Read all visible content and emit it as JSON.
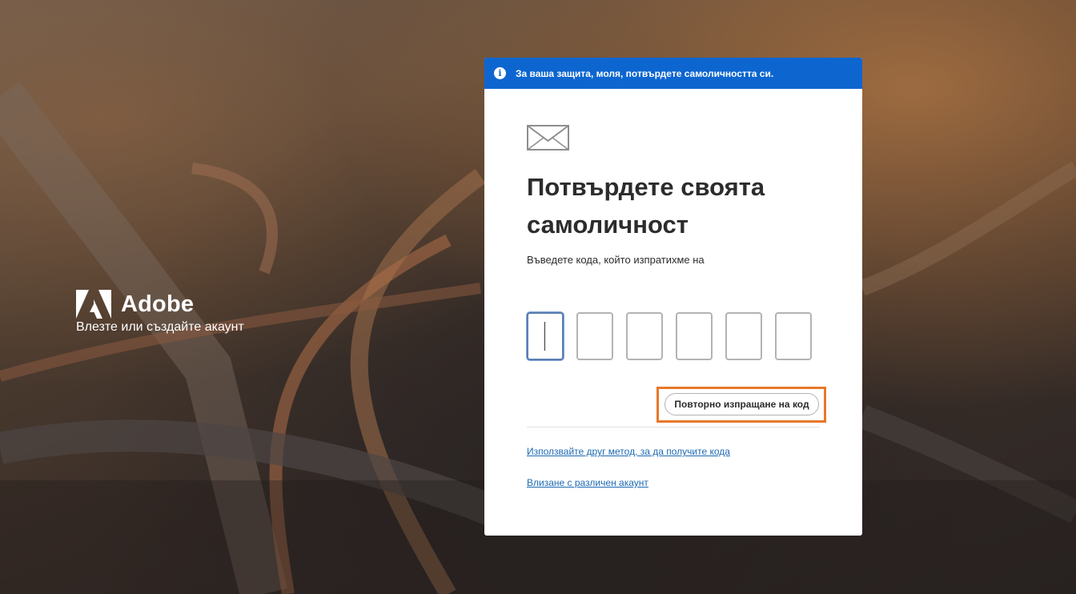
{
  "brand": {
    "name": "Adobe",
    "subtitle": "Влезте или създайте акаунт"
  },
  "banner": {
    "icon": "info-icon",
    "text": "За ваша защита, моля, потвърдете самоличността си."
  },
  "card": {
    "envelope_icon": "envelope-icon",
    "title": "Потвърдете своята самоличност",
    "subtitle": "Въведете кода, който изпратихме на",
    "code_digits": [
      "",
      "",
      "",
      "",
      "",
      ""
    ],
    "resend_label": "Повторно изпращане на код",
    "alt_method_link": "Използвайте друг метод, за да получите кода",
    "other_account_link": "Влизане с различен акаунт"
  },
  "colors": {
    "banner_bg": "#0d66d0",
    "highlight": "#e8782a",
    "link": "#1d6ab3"
  }
}
